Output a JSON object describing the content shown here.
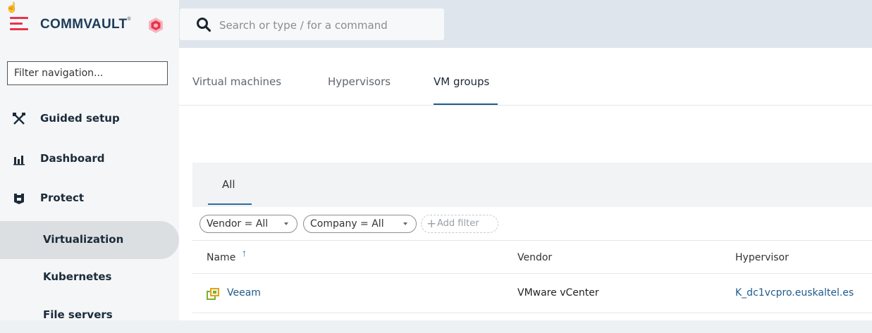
{
  "app": {
    "brand": "COMMVAULT",
    "trademark": "®",
    "accent_color": "#e8334d",
    "brand_color": "#1d3c58"
  },
  "search": {
    "placeholder": "Search or type / for a command"
  },
  "sidebar": {
    "filter_placeholder": "Filter navigation...",
    "items": [
      {
        "label": "Guided setup",
        "icon": "tools-icon"
      },
      {
        "label": "Dashboard",
        "icon": "dashboard-icon"
      },
      {
        "label": "Protect",
        "icon": "shield-icon"
      },
      {
        "label": "Virtualization",
        "icon": null,
        "selected": true
      },
      {
        "label": "Kubernetes",
        "icon": null
      },
      {
        "label": "File servers",
        "icon": null
      }
    ]
  },
  "main": {
    "tabs": [
      {
        "label": "Virtual machines"
      },
      {
        "label": "Hypervisors"
      },
      {
        "label": "VM groups",
        "active": true
      }
    ],
    "view_tabs": [
      {
        "label": "All",
        "active": true
      }
    ],
    "filters": [
      {
        "label": "Vendor = All"
      },
      {
        "label": "Company = All"
      }
    ],
    "add_filter_label": "Add filter",
    "table": {
      "columns": [
        "Name",
        "Vendor",
        "Hypervisor"
      ],
      "sort_indicator": "↑",
      "rows": [
        {
          "name": "Veeam",
          "vendor": "VMware vCenter",
          "hypervisor": "K_dc1vcpro.euskaltel.es",
          "icon": "vm-group-icon"
        }
      ]
    }
  }
}
